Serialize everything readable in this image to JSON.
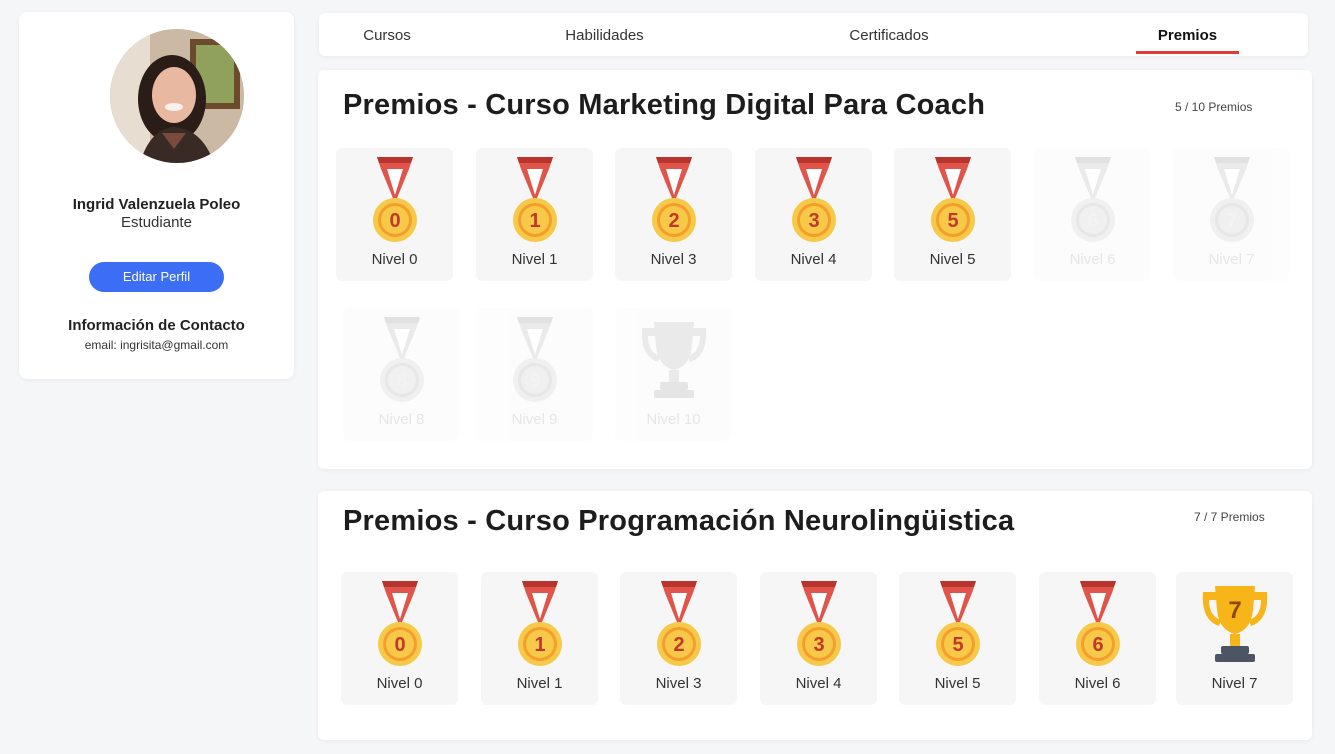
{
  "profile": {
    "name": "Ingrid Valenzuela Poleo",
    "role": "Estudiante",
    "edit_label": "Editar Perfil",
    "contact_title": "Información de Contacto",
    "email": "email:  ingrisita@gmail.com"
  },
  "tabs": [
    {
      "label": "Cursos",
      "active": false
    },
    {
      "label": "Habilidades",
      "active": false
    },
    {
      "label": "Certificados",
      "active": false
    },
    {
      "label": "Premios",
      "active": true
    }
  ],
  "sections": [
    {
      "title": "Premios - Curso Marketing Digital Para Coach",
      "count": "5 / 10 Premios",
      "awards": [
        {
          "label": "Nivel 0",
          "number": "0",
          "kind": "medal",
          "unlocked": true
        },
        {
          "label": "Nivel 1",
          "number": "1",
          "kind": "medal",
          "unlocked": true
        },
        {
          "label": "Nivel 3",
          "number": "2",
          "kind": "medal",
          "unlocked": true
        },
        {
          "label": "Nivel 4",
          "number": "3",
          "kind": "medal",
          "unlocked": true
        },
        {
          "label": "Nivel 5",
          "number": "5",
          "kind": "medal",
          "unlocked": true
        },
        {
          "label": "Nivel 6",
          "number": "6",
          "kind": "medal",
          "unlocked": false
        },
        {
          "label": "Nivel 7",
          "number": "7",
          "kind": "medal",
          "unlocked": false
        },
        {
          "label": "Nivel 8",
          "number": "8",
          "kind": "medal",
          "unlocked": false
        },
        {
          "label": "Nivel 9",
          "number": "9",
          "kind": "medal",
          "unlocked": false
        },
        {
          "label": "Nivel 10",
          "number": "",
          "kind": "trophy",
          "unlocked": false
        }
      ]
    },
    {
      "title": "Premios - Curso Programación Neurolingüistica",
      "count": "7 / 7 Premios",
      "awards": [
        {
          "label": "Nivel 0",
          "number": "0",
          "kind": "medal",
          "unlocked": true
        },
        {
          "label": "Nivel 1",
          "number": "1",
          "kind": "medal",
          "unlocked": true
        },
        {
          "label": "Nivel 3",
          "number": "2",
          "kind": "medal",
          "unlocked": true
        },
        {
          "label": "Nivel 4",
          "number": "3",
          "kind": "medal",
          "unlocked": true
        },
        {
          "label": "Nivel 5",
          "number": "5",
          "kind": "medal",
          "unlocked": true
        },
        {
          "label": "Nivel 6",
          "number": "6",
          "kind": "medal",
          "unlocked": true
        },
        {
          "label": "Nivel 7",
          "number": "7",
          "kind": "trophy",
          "unlocked": true
        }
      ]
    }
  ],
  "colors": {
    "accent_blue": "#3b6ef5",
    "tab_underline": "#e53935",
    "ribbon_red": "#e0544a",
    "medal_gold": "#f7c948",
    "medal_inner": "#f59e2b",
    "trophy_gold": "#f7b51a",
    "trophy_base": "#4b5563",
    "locked_gray": "#d6d6d6"
  }
}
